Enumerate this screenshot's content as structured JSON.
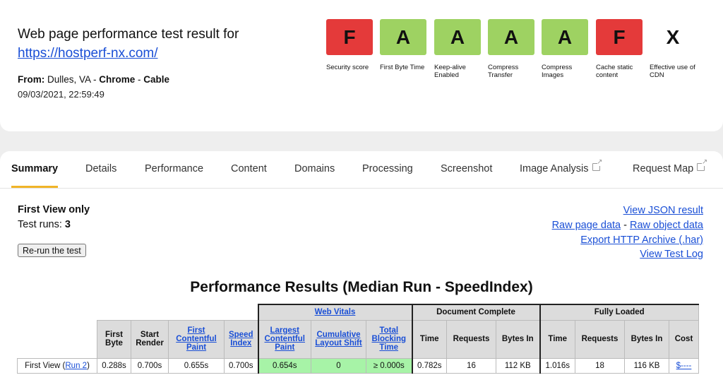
{
  "header": {
    "title": "Web page performance test result for",
    "url": "https://hostperf-nx.com/",
    "from_label": "From:",
    "from_location": " Dulles, VA - ",
    "browser": "Chrome",
    "sep": " - ",
    "connection": "Cable",
    "date": "09/03/2021, 22:59:49"
  },
  "grades": [
    {
      "grade": "F",
      "label": "Security score",
      "color": "#e43a3a"
    },
    {
      "grade": "A",
      "label": "First Byte Time",
      "color": "#9ed262"
    },
    {
      "grade": "A",
      "label": "Keep-alive Enabled",
      "color": "#9ed262"
    },
    {
      "grade": "A",
      "label": "Compress Transfer",
      "color": "#9ed262"
    },
    {
      "grade": "A",
      "label": "Compress Images",
      "color": "#9ed262"
    },
    {
      "grade": "F",
      "label": "Cache static content",
      "color": "#e43a3a"
    },
    {
      "grade": "X",
      "label": "Effective use of CDN",
      "color": "transparent"
    }
  ],
  "tabs": [
    {
      "label": "Summary"
    },
    {
      "label": "Details"
    },
    {
      "label": "Performance"
    },
    {
      "label": "Content"
    },
    {
      "label": "Domains"
    },
    {
      "label": "Processing"
    },
    {
      "label": "Screenshot"
    },
    {
      "label": "Image Analysis"
    },
    {
      "label": "Request Map"
    }
  ],
  "summary": {
    "first_view": "First View only",
    "test_runs_label": "Test runs: ",
    "test_runs_value": "3",
    "rerun_button": "Re-run the test"
  },
  "links": {
    "view_json": "View JSON result",
    "raw_page": "Raw page data",
    "dash": " - ",
    "raw_object": "Raw object data",
    "export_har": "Export HTTP Archive (.har)",
    "view_log": "View Test Log"
  },
  "results": {
    "title": "Performance Results (Median Run - SpeedIndex)",
    "group_web_vitals": "Web Vitals",
    "group_document_complete": "Document Complete",
    "group_fully_loaded": "Fully Loaded",
    "columns": {
      "first_byte": "First Byte",
      "start_render": "Start Render",
      "fcp": "First Contentful Paint",
      "speed_index": "Speed Index",
      "lcp": "Largest Contentful Paint",
      "cls": "Cumulative Layout Shift",
      "tbt": "Total Blocking Time",
      "doc_time": "Time",
      "doc_requests": "Requests",
      "doc_bytes": "Bytes In",
      "full_time": "Time",
      "full_requests": "Requests",
      "full_bytes": "Bytes In",
      "cost": "Cost"
    },
    "row": {
      "label_prefix": "First View (",
      "run_link": "Run 2",
      "label_suffix": ")",
      "first_byte": "0.288s",
      "start_render": "0.700s",
      "fcp": "0.655s",
      "speed_index": "0.700s",
      "lcp": "0.654s",
      "cls": "0",
      "tbt": "≥ 0.000s",
      "doc_time": "0.782s",
      "doc_requests": "16",
      "doc_bytes": "112 KB",
      "full_time": "1.016s",
      "full_requests": "18",
      "full_bytes": "116 KB",
      "cost": "$----"
    }
  }
}
